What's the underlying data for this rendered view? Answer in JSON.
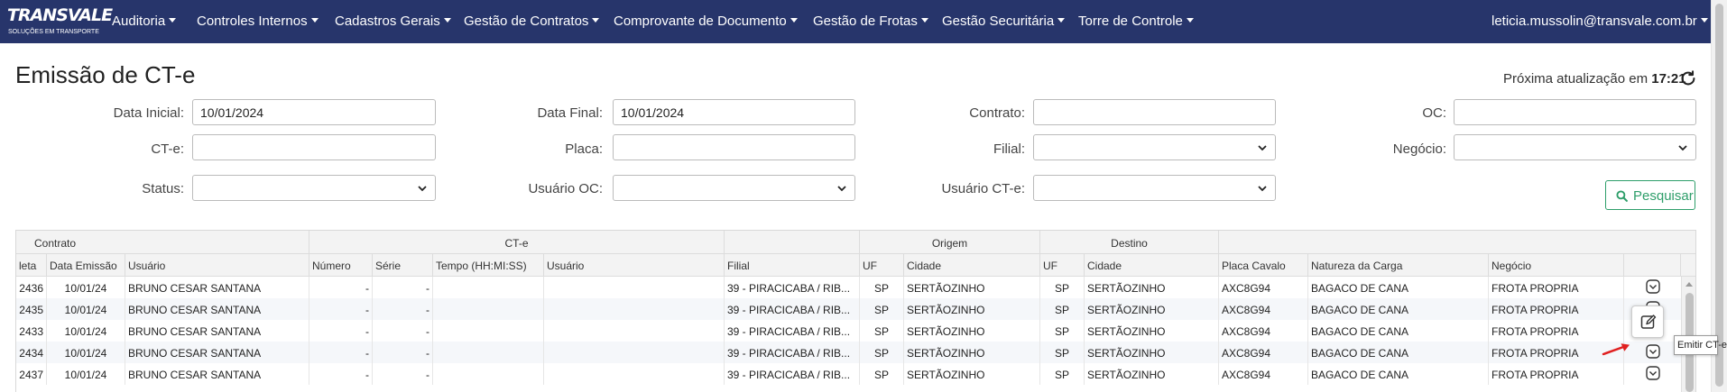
{
  "nav": {
    "logo_main": "TRANSVALE",
    "logo_sub": "SOLUÇÕES EM TRANSPORTE",
    "items": [
      {
        "label": "Auditoria"
      },
      {
        "label": "Controles Internos"
      },
      {
        "label": "Cadastros Gerais"
      },
      {
        "label": "Gestão de Contratos"
      },
      {
        "label": "Comprovante de Documento"
      },
      {
        "label": "Gestão de Frotas"
      },
      {
        "label": "Gestão Securitária"
      },
      {
        "label": "Torre de Controle"
      }
    ],
    "user": "leticia.mussolin@transvale.com.br",
    "bg_color": "#27356b"
  },
  "page": {
    "title": "Emissão de CT-e",
    "refresh_text": "Próxima atualização em",
    "refresh_time": "17:21",
    "refresh_icon": "refresh-icon"
  },
  "filters": {
    "data_inicial": {
      "label": "Data Inicial:",
      "value": "10/01/2024"
    },
    "data_final": {
      "label": "Data Final:",
      "value": "10/01/2024"
    },
    "contrato": {
      "label": "Contrato:",
      "value": ""
    },
    "oc": {
      "label": "OC:",
      "value": ""
    },
    "cte": {
      "label": "CT-e:",
      "value": ""
    },
    "placa": {
      "label": "Placa:",
      "value": ""
    },
    "filial": {
      "label": "Filial:",
      "value": ""
    },
    "negocio": {
      "label": "Negócio:",
      "value": ""
    },
    "status": {
      "label": "Status:",
      "value": ""
    },
    "usuario_oc": {
      "label": "Usuário OC:",
      "value": ""
    },
    "usuario_cte": {
      "label": "Usuário CT-e:",
      "value": ""
    },
    "search_button": "Pesquisar",
    "accent_color": "#2e9e6a"
  },
  "grid": {
    "groups": [
      "Contrato",
      "CT-e",
      "",
      "Origem",
      "Destino",
      ""
    ],
    "columns": [
      "leta",
      "Data Emissão",
      "Usuário",
      "Número",
      "Série",
      "Tempo (HH:MI:SS)",
      "Usuário",
      "Filial",
      "UF",
      "Cidade",
      "UF",
      "Cidade",
      "Placa Cavalo",
      "Natureza da Carga",
      "Negócio"
    ],
    "rows": [
      {
        "id": "2436",
        "data": "10/01/24",
        "usuario": "BRUNO CESAR SANTANA",
        "numero": "-",
        "serie": "-",
        "tempo": "",
        "usuario_cte": "",
        "filial": "39 - PIRACICABA / RIB...",
        "uf_o": "SP",
        "cidade_o": "SERTÃOZINHO",
        "uf_d": "SP",
        "cidade_d": "SERTÃOZINHO",
        "placa": "AXC8G94",
        "natureza": "BAGACO DE CANA",
        "negocio": "FROTA PROPRIA"
      },
      {
        "id": "2435",
        "data": "10/01/24",
        "usuario": "BRUNO CESAR SANTANA",
        "numero": "-",
        "serie": "-",
        "tempo": "",
        "usuario_cte": "",
        "filial": "39 - PIRACICABA / RIB...",
        "uf_o": "SP",
        "cidade_o": "SERTÃOZINHO",
        "uf_d": "SP",
        "cidade_d": "SERTÃOZINHO",
        "placa": "AXC8G94",
        "natureza": "BAGACO DE CANA",
        "negocio": "FROTA PROPRIA"
      },
      {
        "id": "2433",
        "data": "10/01/24",
        "usuario": "BRUNO CESAR SANTANA",
        "numero": "-",
        "serie": "-",
        "tempo": "",
        "usuario_cte": "",
        "filial": "39 - PIRACICABA / RIB...",
        "uf_o": "SP",
        "cidade_o": "SERTÃOZINHO",
        "uf_d": "SP",
        "cidade_d": "SERTÃOZINHO",
        "placa": "AXC8G94",
        "natureza": "BAGACO DE CANA",
        "negocio": "FROTA PROPRIA"
      },
      {
        "id": "2434",
        "data": "10/01/24",
        "usuario": "BRUNO CESAR SANTANA",
        "numero": "-",
        "serie": "-",
        "tempo": "",
        "usuario_cte": "",
        "filial": "39 - PIRACICABA / RIB...",
        "uf_o": "SP",
        "cidade_o": "SERTÃOZINHO",
        "uf_d": "SP",
        "cidade_d": "SERTÃOZINHO",
        "placa": "AXC8G94",
        "natureza": "BAGACO DE CANA",
        "negocio": "FROTA PROPRIA"
      },
      {
        "id": "2437",
        "data": "10/01/24",
        "usuario": "BRUNO CESAR SANTANA",
        "numero": "-",
        "serie": "-",
        "tempo": "",
        "usuario_cte": "",
        "filial": "39 - PIRACICABA / RIB...",
        "uf_o": "SP",
        "cidade_o": "SERTÃOZINHO",
        "uf_d": "SP",
        "cidade_d": "SERTÃOZINHO",
        "placa": "AXC8G94",
        "natureza": "BAGACO DE CANA",
        "negocio": "FROTA PROPRIA"
      }
    ],
    "row_action_icon": "chevron-circle-icon",
    "popup_icon": "edit-icon",
    "tooltip": "Emitir CT-e",
    "arrow_color": "#e02020"
  }
}
